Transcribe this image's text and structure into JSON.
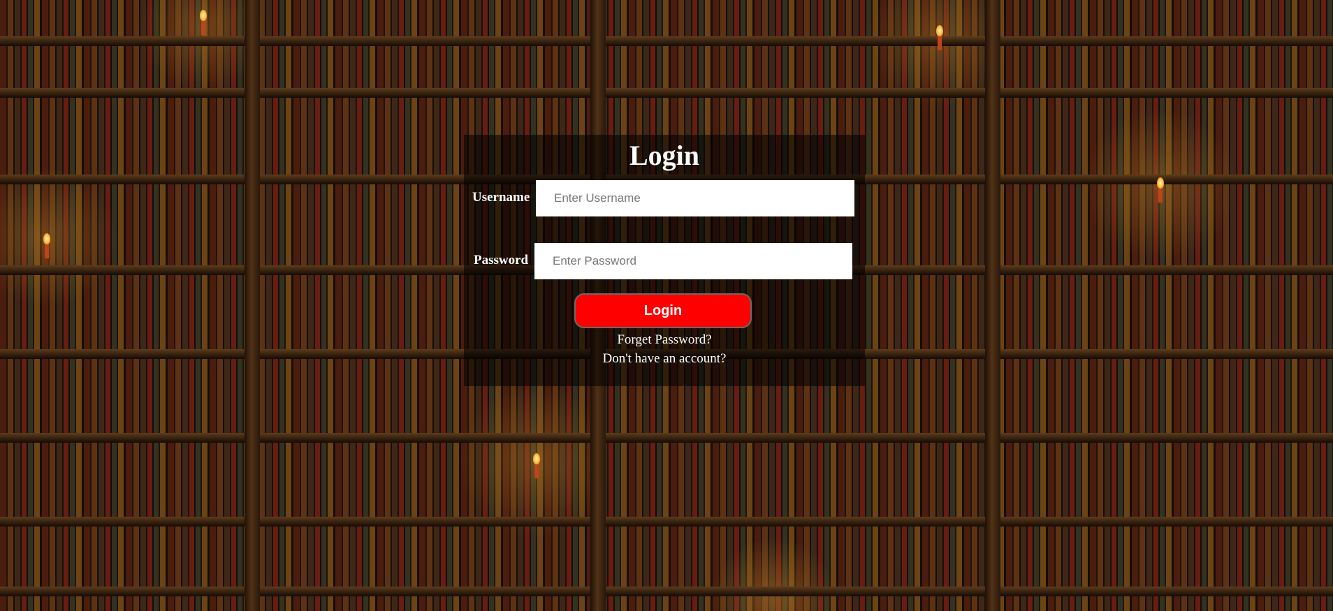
{
  "login": {
    "title": "Login",
    "username_label": "Username",
    "username_placeholder": "Enter Username",
    "username_value": "",
    "password_label": "Password",
    "password_placeholder": "Enter Password",
    "password_value": "",
    "submit_label": "Login",
    "forgot_link": "Forget Password?",
    "signup_link": "Don't have an account?"
  },
  "colors": {
    "button": "#ff0000",
    "panel": "rgba(0,0,0,0.55)",
    "text": "#ffffff"
  }
}
